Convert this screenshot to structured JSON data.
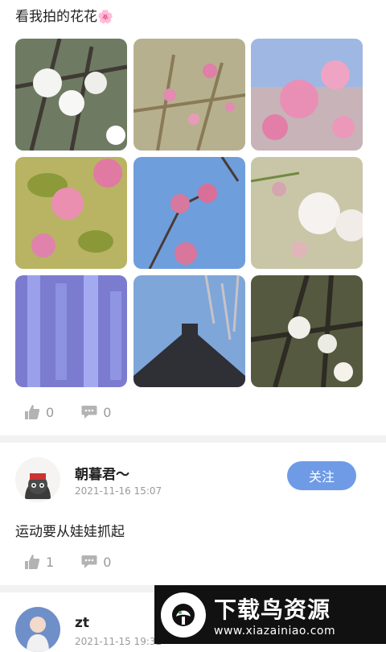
{
  "post1": {
    "caption": "看我拍的花花",
    "caption_emoji": "🌸",
    "photos": [
      {
        "alt": "white cherry blossoms",
        "bg": "#6f7a62",
        "accent": "#f4f4f2"
      },
      {
        "alt": "pink blossoms with sky",
        "bg": "#b7b08f",
        "accent": "#e38bb0"
      },
      {
        "alt": "pink cherry blossom cluster",
        "bg": "#c7b3b8",
        "accent": "#e98fb6"
      },
      {
        "alt": "pink flowers with leaves",
        "bg": "#b9b463",
        "accent": "#ea8fb0"
      },
      {
        "alt": "pink blossoms on blue sky",
        "bg": "#6e9edc",
        "accent": "#d7789e"
      },
      {
        "alt": "white double blossoms",
        "bg": "#c9c6a7",
        "accent": "#f6f2ef"
      },
      {
        "alt": "purple wisteria",
        "bg": "#7b7ccf",
        "accent": "#9aa1ea"
      },
      {
        "alt": "temple roof with blossoms",
        "bg": "#7ea6d8",
        "accent": "#2f2f36"
      },
      {
        "alt": "white blossoms on branch",
        "bg": "#55593f",
        "accent": "#f1efe9"
      }
    ],
    "likes": "0",
    "comments": "0"
  },
  "post2": {
    "username": "朝暮君～",
    "timestamp": "2021-11-16 15:07",
    "follow_label": "关注",
    "text": "运动要从娃娃抓起",
    "likes": "1",
    "comments": "0"
  },
  "post3": {
    "username": "zt",
    "timestamp": "2021-11-15 19:32"
  },
  "watermark": {
    "title": "下载鸟资源",
    "url": "www.xiazainiao.com"
  },
  "colors": {
    "accent": "#6f9be6",
    "muted": "#9a9a9a",
    "divider": "#f2f2f2"
  }
}
